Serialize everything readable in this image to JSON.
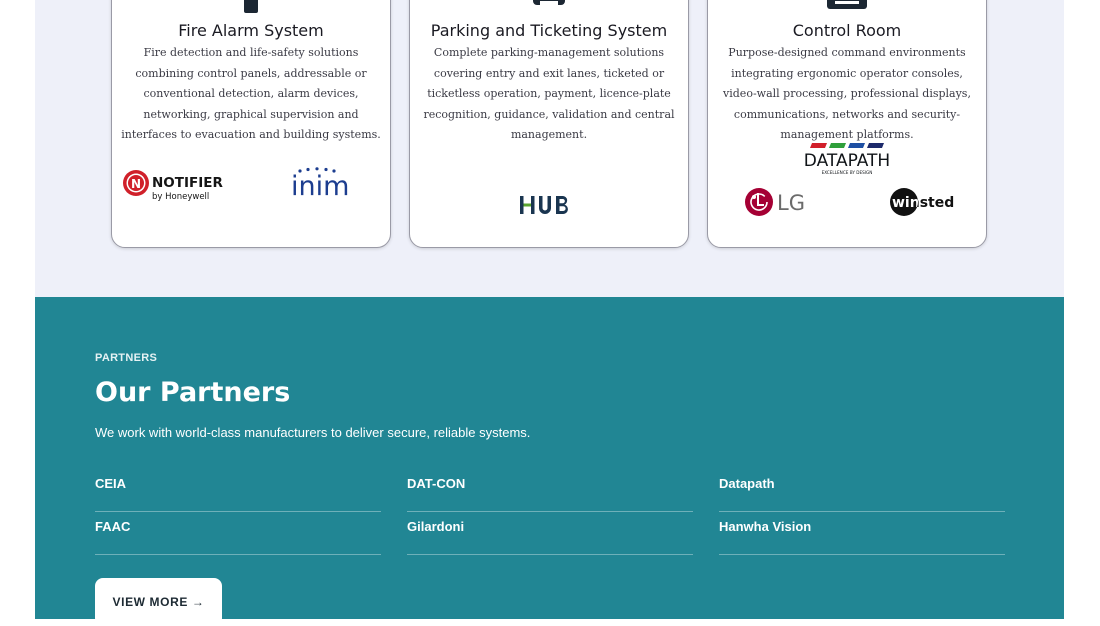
{
  "services": {
    "cards": [
      {
        "title": "Fire Alarm System",
        "description": "Fire detection and life-safety solutions combining control panels, addressable or conventional detection, alarm devices, networking, graphical supervision and interfaces to evacuation and building systems.",
        "logos": [
          {
            "name": "notifier-logo",
            "text": "NOTIFIER",
            "sub": "by Honeywell",
            "mark": "N"
          },
          {
            "name": "inim-logo",
            "text": "inim"
          }
        ]
      },
      {
        "title": "Parking and Ticketing System",
        "description": "Complete parking-management solutions covering entry and exit lanes, ticketed or ticketless operation, payment, licence-plate recognition, guidance, validation and central management.",
        "logos": [
          {
            "name": "hub-logo",
            "text": "HUB"
          }
        ]
      },
      {
        "title": "Control Room",
        "description": "Purpose-designed command environments integrating ergonomic operator consoles, video-wall processing, professional displays, communications, networks and security-management platforms.",
        "logos": [
          {
            "name": "datapath-logo",
            "text": "DATAPATH",
            "sub": "EXCELLENCE BY DESIGN"
          },
          {
            "name": "lg-logo",
            "text": "LG"
          },
          {
            "name": "winsted-logo",
            "text": "winsted"
          }
        ]
      }
    ]
  },
  "partners": {
    "eyebrow": "PARTNERS",
    "title": "Our Partners",
    "subtitle": "We work with world-class manufacturers to deliver secure, reliable systems.",
    "items": [
      "CEIA",
      "DAT-CON",
      "Datapath",
      "FAAC",
      "Gilardoni",
      "Hanwha Vision"
    ],
    "view_more": "VIEW MORE →"
  },
  "colors": {
    "services_bg": "#eef0f9",
    "partners_bg": "#218694",
    "lg_red": "#a50034",
    "notifier_red": "#d0202a",
    "inim_blue": "#1c3d8f",
    "hub_navy": "#1a3550",
    "hub_green": "#5aa52f"
  }
}
